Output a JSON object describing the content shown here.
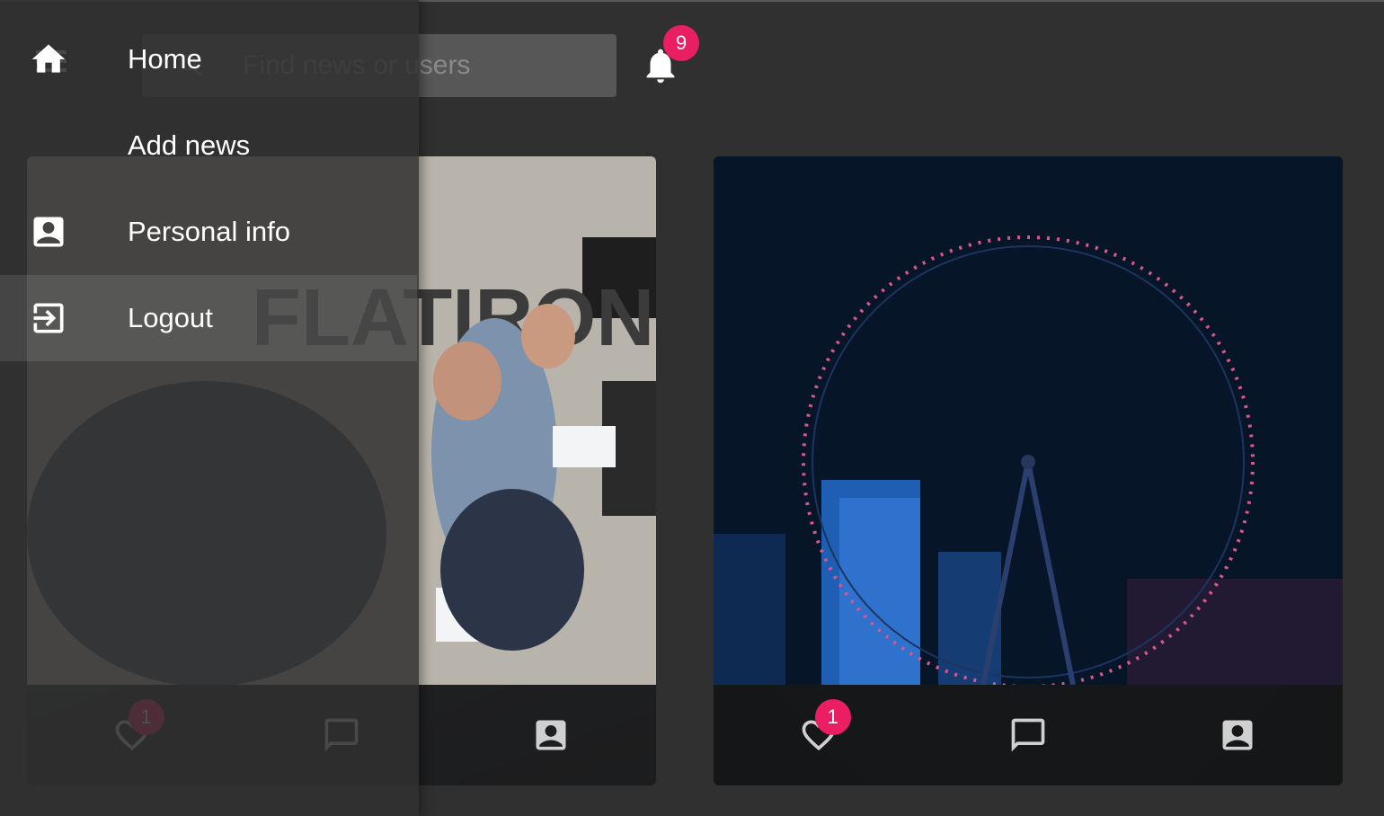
{
  "header": {
    "search_placeholder": "Find news or users",
    "notifications_count": "9"
  },
  "drawer": {
    "items": [
      {
        "label": "Home",
        "icon": "home-icon"
      },
      {
        "label": "Add news",
        "icon": ""
      },
      {
        "label": "Personal info",
        "icon": "account-box-icon"
      },
      {
        "label": "Logout",
        "icon": "logout-icon"
      }
    ],
    "active_index": 3
  },
  "cards": [
    {
      "image": "group-photo-certificates",
      "likes_count": "1",
      "icons": [
        "heart-icon",
        "comment-icon",
        "account-box-icon"
      ]
    },
    {
      "image": "ferris-wheel-night",
      "likes_count": "1",
      "icons": [
        "heart-icon",
        "comment-icon",
        "account-box-icon"
      ]
    }
  ],
  "colors": {
    "background": "#303030",
    "accent_badge": "#e91e63",
    "drawer": "#303030"
  }
}
